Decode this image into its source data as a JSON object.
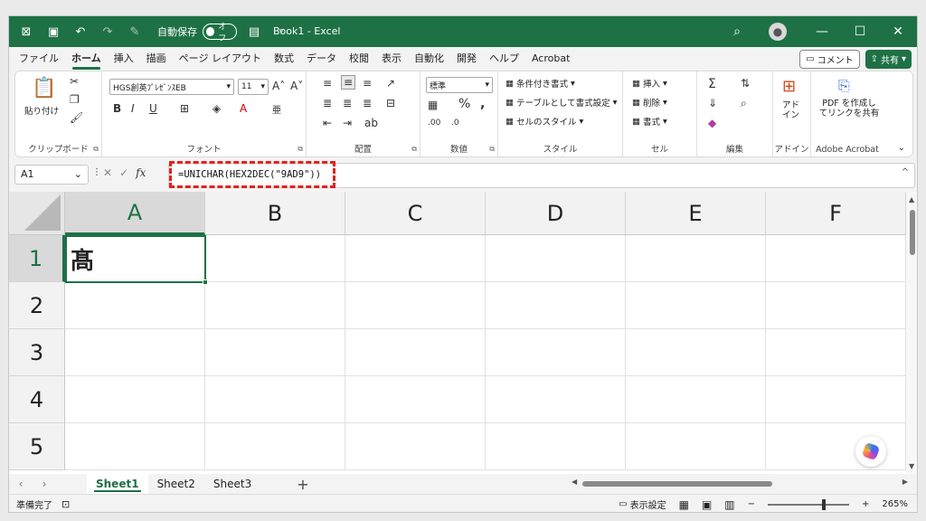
{
  "titlebar": {
    "autosave_label": "自動保存",
    "autosave_state": "オフ",
    "doc_title": "Book1  -  Excel"
  },
  "menu": {
    "tabs": [
      "ファイル",
      "ホーム",
      "挿入",
      "描画",
      "ページ レイアウト",
      "数式",
      "データ",
      "校閲",
      "表示",
      "自動化",
      "開発",
      "ヘルプ",
      "Acrobat"
    ],
    "comment": "コメント",
    "share": "共有"
  },
  "ribbon": {
    "clipboard": {
      "paste": "貼り付け",
      "label": "クリップボード"
    },
    "font": {
      "name": "HGS創英ﾌﾟﾚｾﾞﾝｽEB",
      "size": "11",
      "label": "フォント"
    },
    "alignment": {
      "label": "配置"
    },
    "number": {
      "format": "標準",
      "label": "数値"
    },
    "styles": {
      "conditional": "条件付き書式",
      "table": "テーブルとして書式設定",
      "cell_styles": "セルのスタイル",
      "label": "スタイル"
    },
    "cells": {
      "insert": "挿入",
      "delete": "削除",
      "format": "書式",
      "label": "セル"
    },
    "editing": {
      "label": "編集"
    },
    "addins": {
      "name": "アド\nイン",
      "label": "アドイン"
    },
    "acrobat": {
      "create": "PDF を作成し\nてリンクを共有",
      "label": "Adobe Acrobat"
    }
  },
  "formula_bar": {
    "name_box": "A1",
    "formula": "=UNICHAR(HEX2DEC(\"9AD9\"))"
  },
  "grid": {
    "columns": [
      "A",
      "B",
      "C",
      "D",
      "E",
      "F"
    ],
    "rows": [
      "1",
      "2",
      "3",
      "4",
      "5"
    ],
    "a1_value": "髙"
  },
  "sheets": [
    "Sheet1",
    "Sheet2",
    "Sheet3"
  ],
  "status": {
    "ready": "準備完了",
    "display_settings": "表示設定",
    "zoom": "265%"
  },
  "colors": {
    "accent": "#1e7145",
    "highlight": "#e2211c"
  }
}
